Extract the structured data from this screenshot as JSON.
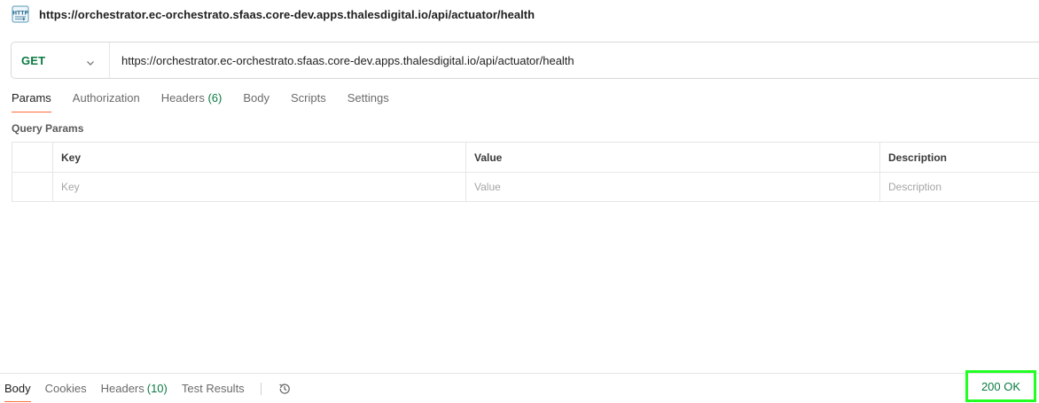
{
  "request": {
    "title": "https://orchestrator.ec-orchestrato.sfaas.core-dev.apps.thalesdigital.io/api/actuator/health",
    "icon": "http-icon",
    "method": "GET",
    "url": "https://orchestrator.ec-orchestrato.sfaas.core-dev.apps.thalesdigital.io/api/actuator/health"
  },
  "tabs": {
    "params": "Params",
    "authorization": "Authorization",
    "headers": "Headers",
    "headers_count": "(6)",
    "body": "Body",
    "scripts": "Scripts",
    "settings": "Settings"
  },
  "query_params": {
    "label": "Query Params",
    "columns": [
      "Key",
      "Value",
      "Description"
    ],
    "placeholders": {
      "key": "Key",
      "value": "Value",
      "description": "Description"
    }
  },
  "response": {
    "tabs": {
      "body": "Body",
      "cookies": "Cookies",
      "headers": "Headers",
      "headers_count": "(10)",
      "test_results": "Test Results"
    },
    "status": "200 OK"
  },
  "colors": {
    "accent_orange": "#ff6c37",
    "method_green": "#0b7a43",
    "highlight_green": "#22ff22"
  }
}
